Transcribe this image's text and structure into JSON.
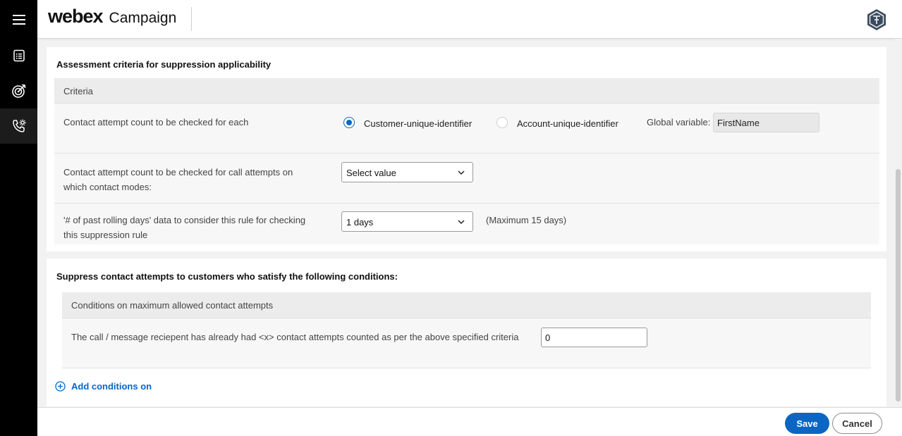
{
  "brand": {
    "logo": "webex",
    "app_name": "Campaign"
  },
  "rail": {
    "icons": [
      "menu-icon",
      "list-icon",
      "target-icon",
      "phone-settings-icon"
    ]
  },
  "section1": {
    "title": "Assessment criteria for suppression applicability",
    "table_header": "Criteria",
    "row1": {
      "label": "Contact attempt count to be checked for each",
      "option1": "Customer-unique-identifier",
      "option2": "Account-unique-identifier",
      "selected": "Customer-unique-identifier",
      "gv_label": "Global variable:",
      "gv_value": "FirstName"
    },
    "row2": {
      "label_line1": "Contact attempt count to be checked for call attempts on",
      "label_line2": "which contact modes:",
      "select_value": "Select value"
    },
    "row3": {
      "label_line1": "'# of past rolling days' data to consider this rule for checking",
      "label_line2": "this suppression rule",
      "select_value": "1 days",
      "hint": "(Maximum 15 days)"
    }
  },
  "section2": {
    "title": "Suppress contact attempts to customers who satisfy the following conditions:",
    "table_header": "Conditions on maximum allowed contact attempts",
    "row1": {
      "label": "The call / message reciepent has already had <x> contact attempts counted as per the above specified criteria",
      "value": "0"
    },
    "add_conditions": "Add conditions on"
  },
  "footer": {
    "save": "Save",
    "cancel": "Cancel"
  },
  "colors": {
    "accent": "#0a66c2",
    "rail": "#000000"
  }
}
